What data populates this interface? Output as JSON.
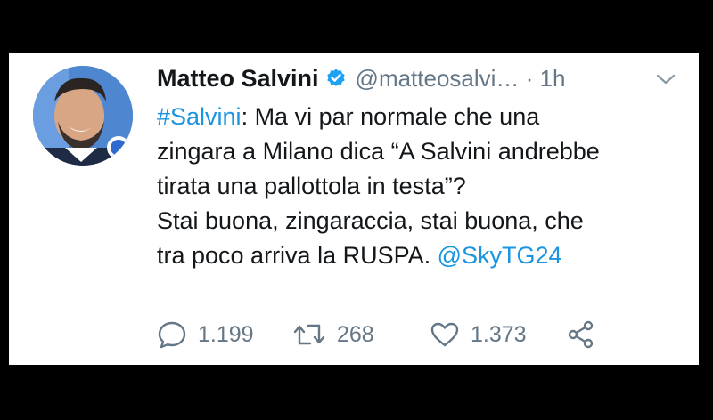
{
  "tweet": {
    "author_name": "Matteo Salvini",
    "handle": "@matteosalvi…",
    "separator": "·",
    "time": "1h",
    "hashtag": "#Salvini",
    "text_line1_rest": ": Ma vi par normale che una",
    "text_line2": "zingara a Milano dica “A Salvini andrebbe",
    "text_line3": "tirata una pallottola in testa”?",
    "text_line4": "Stai buona, zingaraccia, stai buona, che",
    "text_line5_start": "tra poco arriva la RUSPA. ",
    "mention": "@SkyTG24"
  },
  "stats": {
    "replies": "1.199",
    "retweets": "268",
    "likes": "1.373"
  },
  "colors": {
    "link": "#1b95e0",
    "verified": "#1da1f2",
    "muted": "#657786",
    "text": "#14171a"
  },
  "icons": [
    "verified-badge-icon",
    "chevron-down-icon",
    "reply-icon",
    "retweet-icon",
    "like-icon",
    "share-icon"
  ]
}
